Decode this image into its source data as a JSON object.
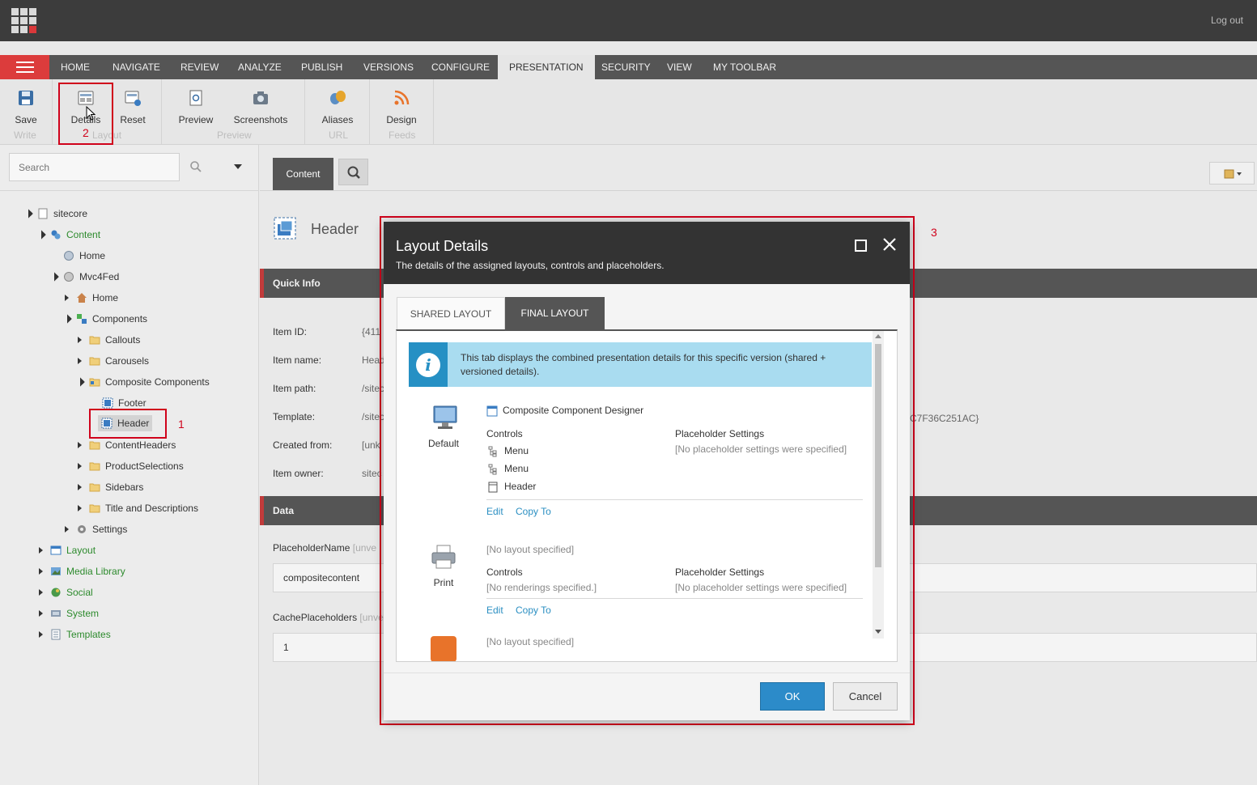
{
  "topbar": {
    "logout": "Log out"
  },
  "ribbon_tabs": [
    "HOME",
    "NAVIGATE",
    "REVIEW",
    "ANALYZE",
    "PUBLISH",
    "VERSIONS",
    "CONFIGURE",
    "PRESENTATION",
    "SECURITY",
    "VIEW",
    "MY TOOLBAR"
  ],
  "ribbon": {
    "save": "Save",
    "details": "Details",
    "reset": "Reset",
    "preview": "Preview",
    "screenshots": "Screenshots",
    "aliases": "Aliases",
    "design": "Design",
    "groups": {
      "write": "Write",
      "layout": "Layout",
      "preview": "Preview",
      "url": "URL",
      "feeds": "Feeds"
    }
  },
  "search": {
    "placeholder": "Search"
  },
  "tree": [
    {
      "label": "sitecore",
      "color": "#333"
    },
    {
      "label": "Content"
    },
    {
      "label": "Home"
    },
    {
      "label": "Mvc4Fed"
    },
    {
      "label": "Home"
    },
    {
      "label": "Components"
    },
    {
      "label": "Callouts"
    },
    {
      "label": "Carousels"
    },
    {
      "label": "Composite Components"
    },
    {
      "label": "Footer"
    },
    {
      "label": "Header"
    },
    {
      "label": "ContentHeaders"
    },
    {
      "label": "ProductSelections"
    },
    {
      "label": "Sidebars"
    },
    {
      "label": "Title and Descriptions"
    },
    {
      "label": "Settings"
    },
    {
      "label": "Layout"
    },
    {
      "label": "Media Library"
    },
    {
      "label": "Social"
    },
    {
      "label": "System"
    },
    {
      "label": "Templates"
    }
  ],
  "content": {
    "tab": "Content",
    "item_title": "Header",
    "quick_info": "Quick Info",
    "labels": {
      "item_id": "Item ID:",
      "item_name": "Item name:",
      "item_path": "Item path:",
      "template": "Template:",
      "created_from": "Created from:",
      "item_owner": "Item owner:"
    },
    "values": {
      "item_id": "{411",
      "item_name": "Head",
      "item_path": "/sitec",
      "template": "/sitec",
      "created_from": "[unk",
      "item_owner": "sitec"
    },
    "template_tail": "C7F36C251AC}",
    "data_section": "Data",
    "fields": {
      "placeholder_label": "PlaceholderName",
      "placeholder_suffix": "[unve",
      "placeholder_value": "compositecontent",
      "cache_label": "CachePlaceholders",
      "cache_suffix": "[unve",
      "cache_value": "1"
    }
  },
  "annotations": {
    "one": "1",
    "two": "2",
    "three": "3"
  },
  "modal": {
    "title": "Layout Details",
    "subtitle": "The details of the assigned layouts, controls and placeholders.",
    "tabs": {
      "shared": "SHARED LAYOUT",
      "final": "FINAL LAYOUT"
    },
    "info": "This tab displays the combined presentation details for this specific version (shared + versioned details).",
    "devices": [
      {
        "name": "Default",
        "layout": "Composite Component Designer",
        "controls_label": "Controls",
        "controls": [
          "Menu",
          "Menu",
          "Header"
        ],
        "ph_label": "Placeholder Settings",
        "ph_value": "[No placeholder settings were specified]",
        "edit": "Edit",
        "copy": "Copy To"
      },
      {
        "name": "Print",
        "layout": "[No layout specified]",
        "controls_label": "Controls",
        "controls_empty": "[No renderings specified.]",
        "ph_label": "Placeholder Settings",
        "ph_value": "[No placeholder settings were specified]",
        "edit": "Edit",
        "copy": "Copy To"
      },
      {
        "layout": "[No layout specified]"
      }
    ],
    "ok": "OK",
    "cancel": "Cancel"
  }
}
